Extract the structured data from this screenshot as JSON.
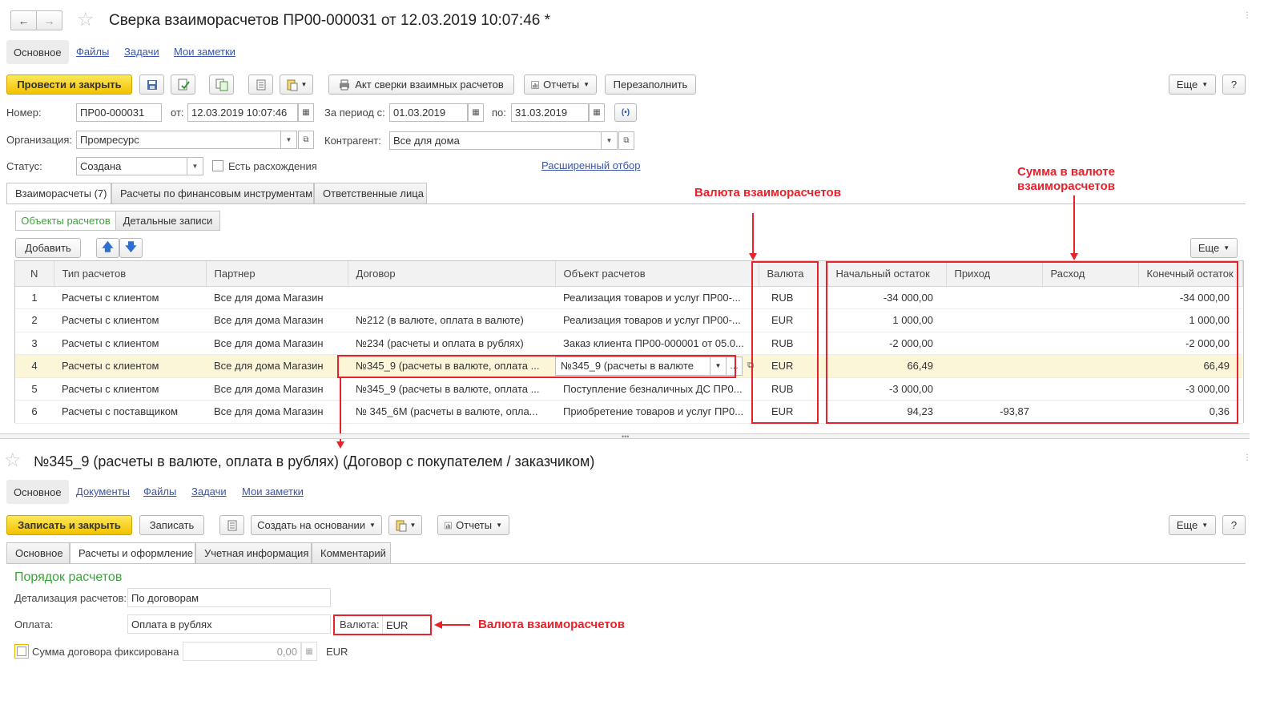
{
  "top": {
    "title": "Сверка взаиморасчетов ПР00-000031 от 12.03.2019 10:07:46 *",
    "nav_back": "←",
    "nav_fwd": "→",
    "tabs": [
      "Основное",
      "Файлы",
      "Задачи",
      "Мои заметки"
    ],
    "toolbar": {
      "post_close": "Провести и закрыть",
      "act_label": "Акт сверки взаимных расчетов",
      "reports": "Отчеты",
      "refill": "Перезаполнить",
      "more": "Еще",
      "help": "?"
    },
    "form": {
      "number_label": "Номер:",
      "number_value": "ПР00-000031",
      "from_label": "от:",
      "from_value": "12.03.2019 10:07:46",
      "period_label": "За период с:",
      "period_from": "01.03.2019",
      "period_to_label": "по:",
      "period_to": "31.03.2019",
      "org_label": "Организация:",
      "org_value": "Промресурс",
      "counterparty_label": "Контрагент:",
      "counterparty_value": "Все для дома",
      "status_label": "Статус:",
      "status_value": "Создана",
      "discrepancy_label": "Есть расхождения",
      "advanced_filter": "Расширенный отбор"
    },
    "form_tabs": [
      "Взаиморасчеты (7)",
      "Расчеты по финансовым инструментам",
      "Ответственные лица"
    ],
    "subtabs": [
      "Объекты расчетов",
      "Детальные записи"
    ],
    "add_btn": "Добавить",
    "more2": "Еще",
    "table": {
      "columns": [
        "N",
        "Тип расчетов",
        "Партнер",
        "Договор",
        "Объект расчетов",
        "Валюта",
        "Начальный остаток",
        "Приход",
        "Расход",
        "Конечный остаток"
      ],
      "rows": [
        [
          "1",
          "Расчеты с клиентом",
          "Все для дома Магазин",
          "",
          "Реализация товаров и услуг ПР00-...",
          "RUB",
          "-34 000,00",
          "",
          "",
          "-34 000,00"
        ],
        [
          "2",
          "Расчеты с клиентом",
          "Все для дома Магазин",
          "№212 (в валюте, оплата в валюте)",
          "Реализация товаров и услуг ПР00-...",
          "EUR",
          "1 000,00",
          "",
          "",
          "1 000,00"
        ],
        [
          "3",
          "Расчеты с клиентом",
          "Все для дома Магазин",
          "№234 (расчеты и оплата в рублях)",
          "Заказ клиента ПР00-000001 от 05.0...",
          "RUB",
          "-2 000,00",
          "",
          "",
          "-2 000,00"
        ],
        [
          "4",
          "Расчеты с клиентом",
          "Все для дома Магазин",
          "№345_9 (расчеты в валюте, оплата ...",
          "№345_9 (расчеты в валюте",
          "EUR",
          "66,49",
          "",
          "",
          "66,49"
        ],
        [
          "5",
          "Расчеты с клиентом",
          "Все для дома Магазин",
          "№345_9 (расчеты в валюте, оплата ...",
          "Поступление безналичных ДС ПР0...",
          "RUB",
          "-3 000,00",
          "",
          "",
          "-3 000,00"
        ],
        [
          "6",
          "Расчеты с поставщиком",
          "Все для дома Магазин",
          "№ 345_6М (расчеты в валюте, опла...",
          "Приобретение товаров и услуг ПР0...",
          "EUR",
          "94,23",
          "-93,87",
          "",
          "0,36"
        ]
      ]
    }
  },
  "annotations": {
    "currency_top": "Валюта взаиморасчетов",
    "sum_line1": "Сумма в валюте",
    "sum_line2": "взаиморасчетов",
    "currency_bottom": "Валюта взаиморасчетов"
  },
  "bottom": {
    "title": "№345_9 (расчеты в валюте, оплата в рублях) (Договор с покупателем / заказчиком)",
    "tabs": [
      "Основное",
      "Документы",
      "Файлы",
      "Задачи",
      "Мои заметки"
    ],
    "toolbar": {
      "write_close": "Записать и закрыть",
      "write": "Записать",
      "create_based": "Создать на основании",
      "reports": "Отчеты",
      "more": "Еще",
      "help": "?"
    },
    "form_tabs": [
      "Основное",
      "Расчеты и оформление",
      "Учетная информация",
      "Комментарий"
    ],
    "section_title": "Порядок расчетов",
    "detail_label": "Детализация расчетов:",
    "detail_value": "По договорам",
    "payment_label": "Оплата:",
    "payment_value": "Оплата в рублях",
    "currency_label": "Валюта:",
    "currency_value": "EUR",
    "fixed_label": "Сумма договора фиксирована",
    "fixed_amount": "0,00",
    "fixed_currency": "EUR"
  }
}
